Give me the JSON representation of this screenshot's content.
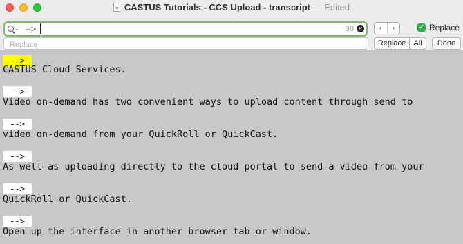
{
  "window": {
    "title": "CASTUS Tutorials - CCS Upload - transcript",
    "separator": "—",
    "status": "Edited"
  },
  "find": {
    "value": "-->",
    "match_count": "38",
    "replace_toggle_label": "Replace",
    "replace_checked": true,
    "nav_prev": "‹",
    "nav_next": "›",
    "clear_glyph": "×"
  },
  "replace": {
    "placeholder": "Replace",
    "value": "",
    "replace_button": "Replace",
    "all_button": "All",
    "done_button": "Done"
  },
  "document": {
    "markers": [
      "-->",
      "-->",
      "-->",
      "-->",
      "-->",
      "-->"
    ],
    "lines": [
      "CASTUS Cloud Services.",
      "Video on-demand has two convenient ways to upload content through send to",
      "video on-demand from your QuickRoll or QuickCast.",
      "As well as uploading directly to the cloud portal to send a video from your",
      "QuickRoll or QuickCast.",
      "Open up the interface in another browser tab or window."
    ]
  },
  "colors": {
    "highlight_current": "#ffff00",
    "highlight_other": "#ffffff",
    "search_focus": "#7fb96e",
    "checkbox": "#33a84a",
    "content_bg": "#c8c8c8"
  },
  "icons": [
    "close-window-icon",
    "minimize-window-icon",
    "zoom-window-icon",
    "document-icon",
    "magnifier-icon",
    "clear-icon",
    "chevron-left-icon",
    "chevron-right-icon",
    "checkmark-icon"
  ]
}
